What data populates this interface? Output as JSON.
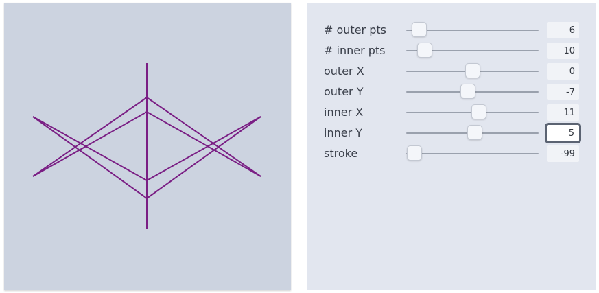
{
  "canvas": {
    "stroke_color": "#7a1e84",
    "background": "#ccd3e0"
  },
  "controls": [
    {
      "key": "outer_pts",
      "label": "# outer pts",
      "value": "6",
      "level": 0.1
    },
    {
      "key": "inner_pts",
      "label": "# inner pts",
      "value": "10",
      "level": 0.14
    },
    {
      "key": "outer_x",
      "label": "outer X",
      "value": "0",
      "level": 0.5
    },
    {
      "key": "outer_y",
      "label": "outer Y",
      "value": "-7",
      "level": 0.465
    },
    {
      "key": "inner_x",
      "label": "inner X",
      "value": "11",
      "level": 0.55
    },
    {
      "key": "inner_y",
      "label": "inner Y",
      "value": "5",
      "level": 0.52
    },
    {
      "key": "stroke",
      "label": "stroke",
      "value": "-99",
      "level": 0.06
    }
  ]
}
